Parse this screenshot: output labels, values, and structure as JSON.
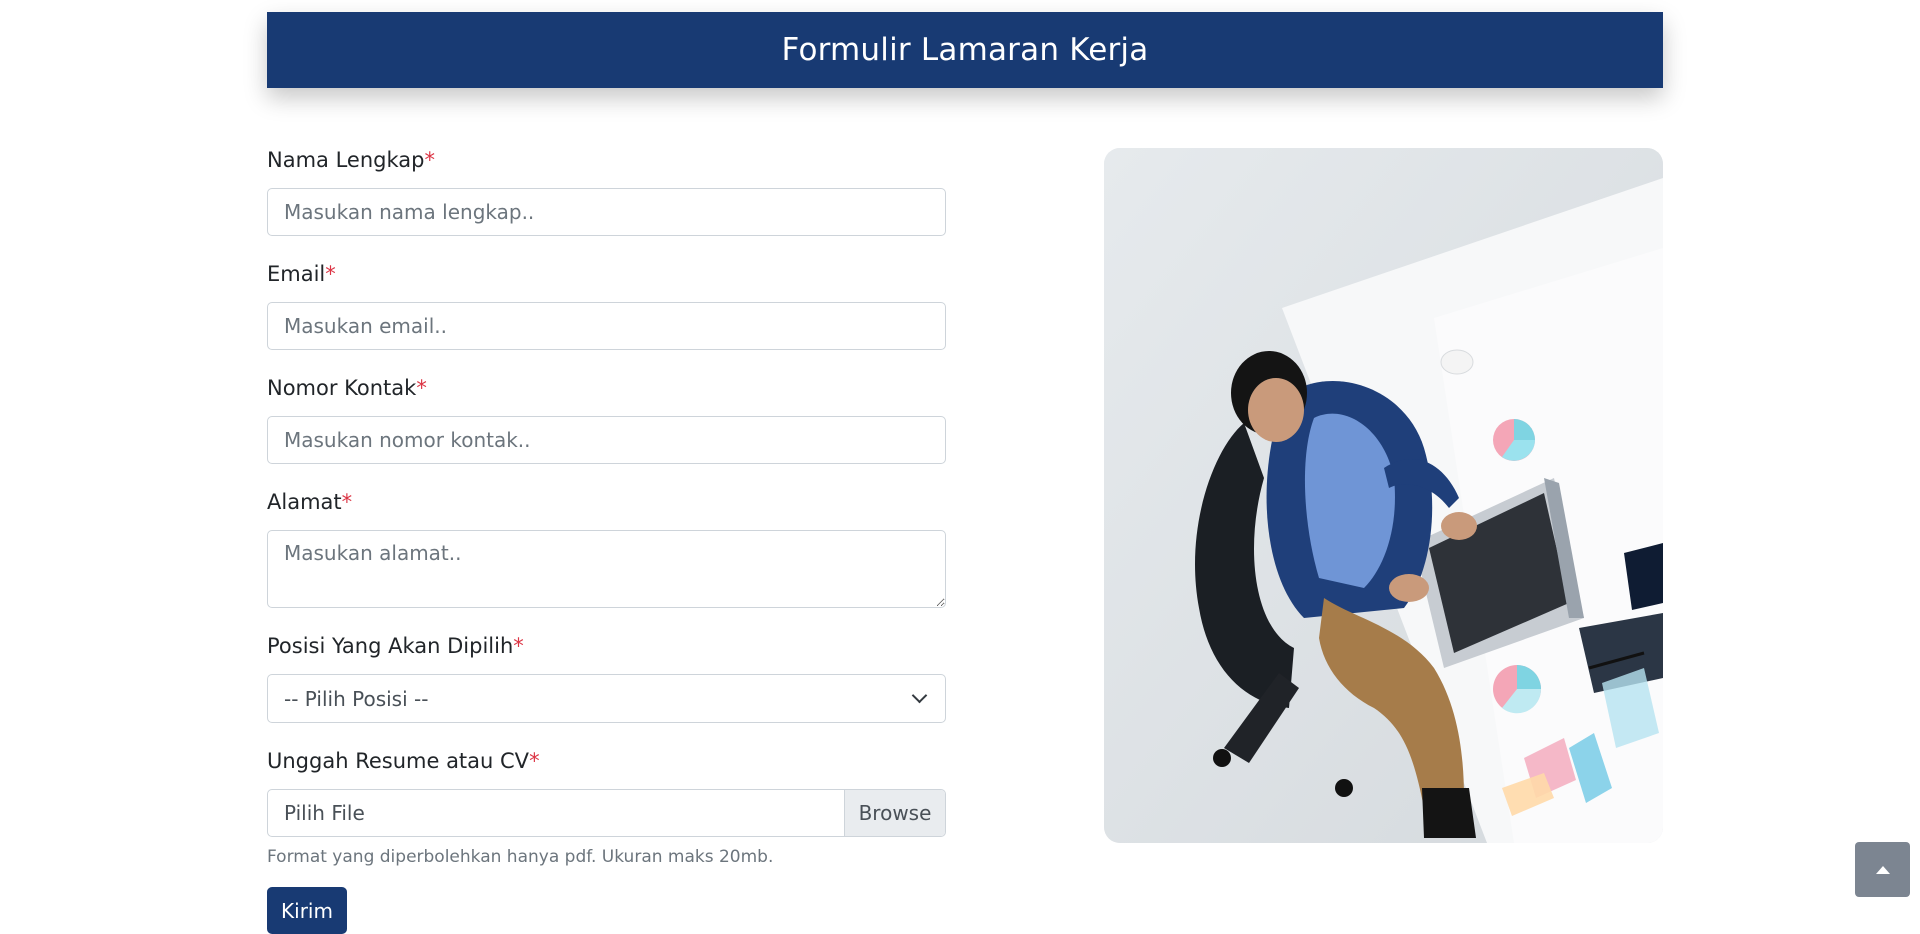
{
  "header": {
    "title": "Formulir Lamaran Kerja"
  },
  "form": {
    "required_mark": "*",
    "full_name": {
      "label": "Nama Lengkap",
      "placeholder": "Masukan nama lengkap..",
      "value": ""
    },
    "email": {
      "label": "Email",
      "placeholder": "Masukan email..",
      "value": ""
    },
    "contact": {
      "label": "Nomor Kontak",
      "placeholder": "Masukan nomor kontak..",
      "value": ""
    },
    "address": {
      "label": "Alamat",
      "placeholder": "Masukan alamat..",
      "value": ""
    },
    "position": {
      "label": "Posisi Yang Akan Dipilih",
      "selected": "-- Pilih Posisi --"
    },
    "resume": {
      "label": "Unggah Resume atau CV",
      "file_text": "Pilih File",
      "browse_label": "Browse",
      "help": "Format yang diperbolehkan hanya pdf. Ukuran maks 20mb."
    },
    "submit_label": "Kirim"
  },
  "illustration": {
    "icon": "office-worker-laptop-photo"
  },
  "scroll_top": {
    "icon": "caret-up-icon"
  },
  "colors": {
    "primary": "#183a73",
    "required": "#dc3545",
    "scroll_top_bg": "#7c8591"
  }
}
